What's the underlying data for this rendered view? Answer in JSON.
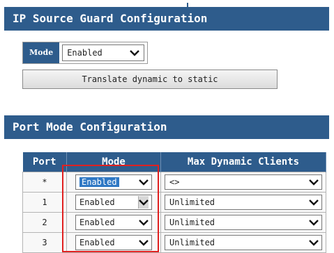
{
  "ip_source_guard": {
    "title": "IP Source Guard Configuration",
    "mode_label": "Mode",
    "mode_value": "Enabled",
    "translate_button": "Translate dynamic to static"
  },
  "port_mode": {
    "title": "Port Mode Configuration",
    "columns": {
      "port": "Port",
      "mode": "Mode",
      "max": "Max Dynamic Clients"
    },
    "rows": [
      {
        "port": "*",
        "mode": "Enabled",
        "max": "<>"
      },
      {
        "port": "1",
        "mode": "Enabled",
        "max": "Unlimited"
      },
      {
        "port": "2",
        "mode": "Enabled",
        "max": "Unlimited"
      },
      {
        "port": "3",
        "mode": "Enabled",
        "max": "Unlimited"
      }
    ]
  },
  "colors": {
    "header_bg": "#2e5c8c",
    "highlight": "#e02020",
    "selected": "#2f78c4"
  },
  "icons": {
    "dropdown": "chevron-down-icon"
  }
}
